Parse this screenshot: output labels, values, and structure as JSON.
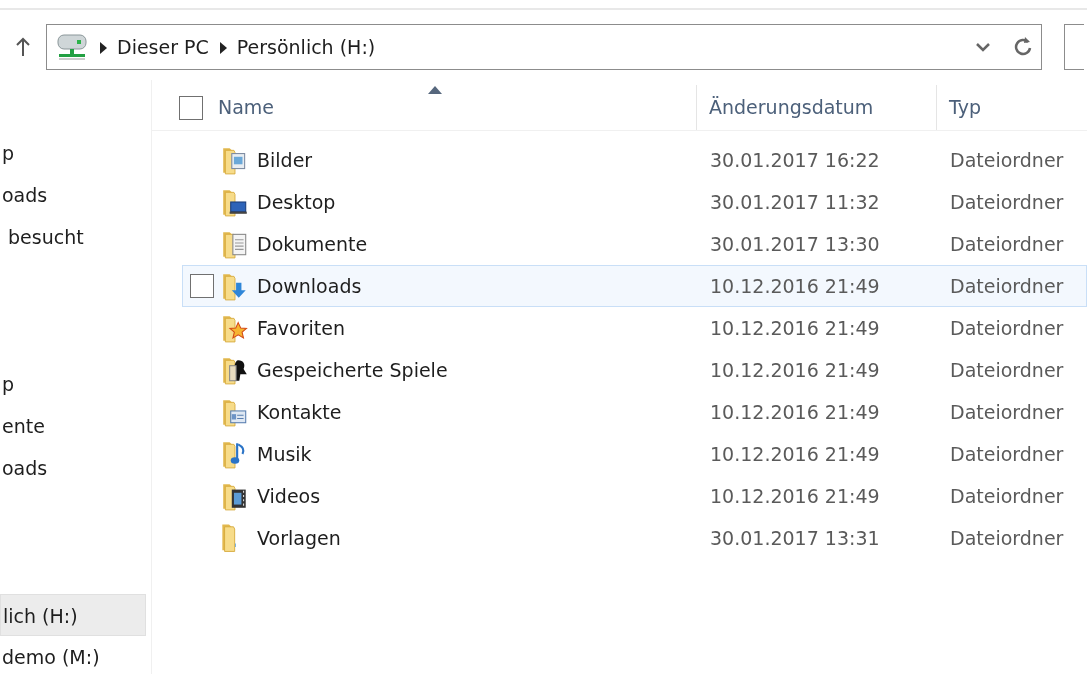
{
  "address_bar": {
    "breadcrumbs": [
      "Dieser PC",
      "Persönlich (H:)"
    ]
  },
  "sidebar": {
    "sections": [
      {
        "items": [
          {
            "label": "p",
            "selected": false
          },
          {
            "label": "oads",
            "selected": false
          },
          {
            "label": " besucht",
            "selected": false
          }
        ]
      },
      {
        "items": [
          {
            "label": "p",
            "selected": false
          },
          {
            "label": "ente",
            "selected": false
          },
          {
            "label": "oads",
            "selected": false
          }
        ]
      },
      {
        "items": [
          {
            "label": "lich (H:)",
            "selected": true
          },
          {
            "label": "demo (M:)",
            "selected": false
          }
        ]
      }
    ]
  },
  "table": {
    "select_all_checked": false,
    "columns": [
      {
        "label": "Name",
        "sorted": true
      },
      {
        "label": "Änderungsdatum",
        "sorted": false
      },
      {
        "label": "Typ",
        "sorted": false
      }
    ],
    "rows": [
      {
        "name": "Bilder",
        "modified": "30.01.2017 16:22",
        "type": "Dateiordner",
        "kind": "pictures",
        "hovered": false,
        "checked": false
      },
      {
        "name": "Desktop",
        "modified": "30.01.2017 11:32",
        "type": "Dateiordner",
        "kind": "desktop",
        "hovered": false,
        "checked": false
      },
      {
        "name": "Dokumente",
        "modified": "30.01.2017 13:30",
        "type": "Dateiordner",
        "kind": "documents",
        "hovered": false,
        "checked": false
      },
      {
        "name": "Downloads",
        "modified": "10.12.2016 21:49",
        "type": "Dateiordner",
        "kind": "downloads",
        "hovered": true,
        "checked": false
      },
      {
        "name": "Favoriten",
        "modified": "10.12.2016 21:49",
        "type": "Dateiordner",
        "kind": "favorites",
        "hovered": false,
        "checked": false
      },
      {
        "name": "Gespeicherte Spiele",
        "modified": "10.12.2016 21:49",
        "type": "Dateiordner",
        "kind": "games",
        "hovered": false,
        "checked": false
      },
      {
        "name": "Kontakte",
        "modified": "10.12.2016 21:49",
        "type": "Dateiordner",
        "kind": "contacts",
        "hovered": false,
        "checked": false
      },
      {
        "name": "Musik",
        "modified": "10.12.2016 21:49",
        "type": "Dateiordner",
        "kind": "music",
        "hovered": false,
        "checked": false
      },
      {
        "name": "Videos",
        "modified": "10.12.2016 21:49",
        "type": "Dateiordner",
        "kind": "videos",
        "hovered": false,
        "checked": false
      },
      {
        "name": "Vorlagen",
        "modified": "30.01.2017 13:31",
        "type": "Dateiordner",
        "kind": "plain",
        "hovered": false,
        "checked": false
      }
    ]
  }
}
